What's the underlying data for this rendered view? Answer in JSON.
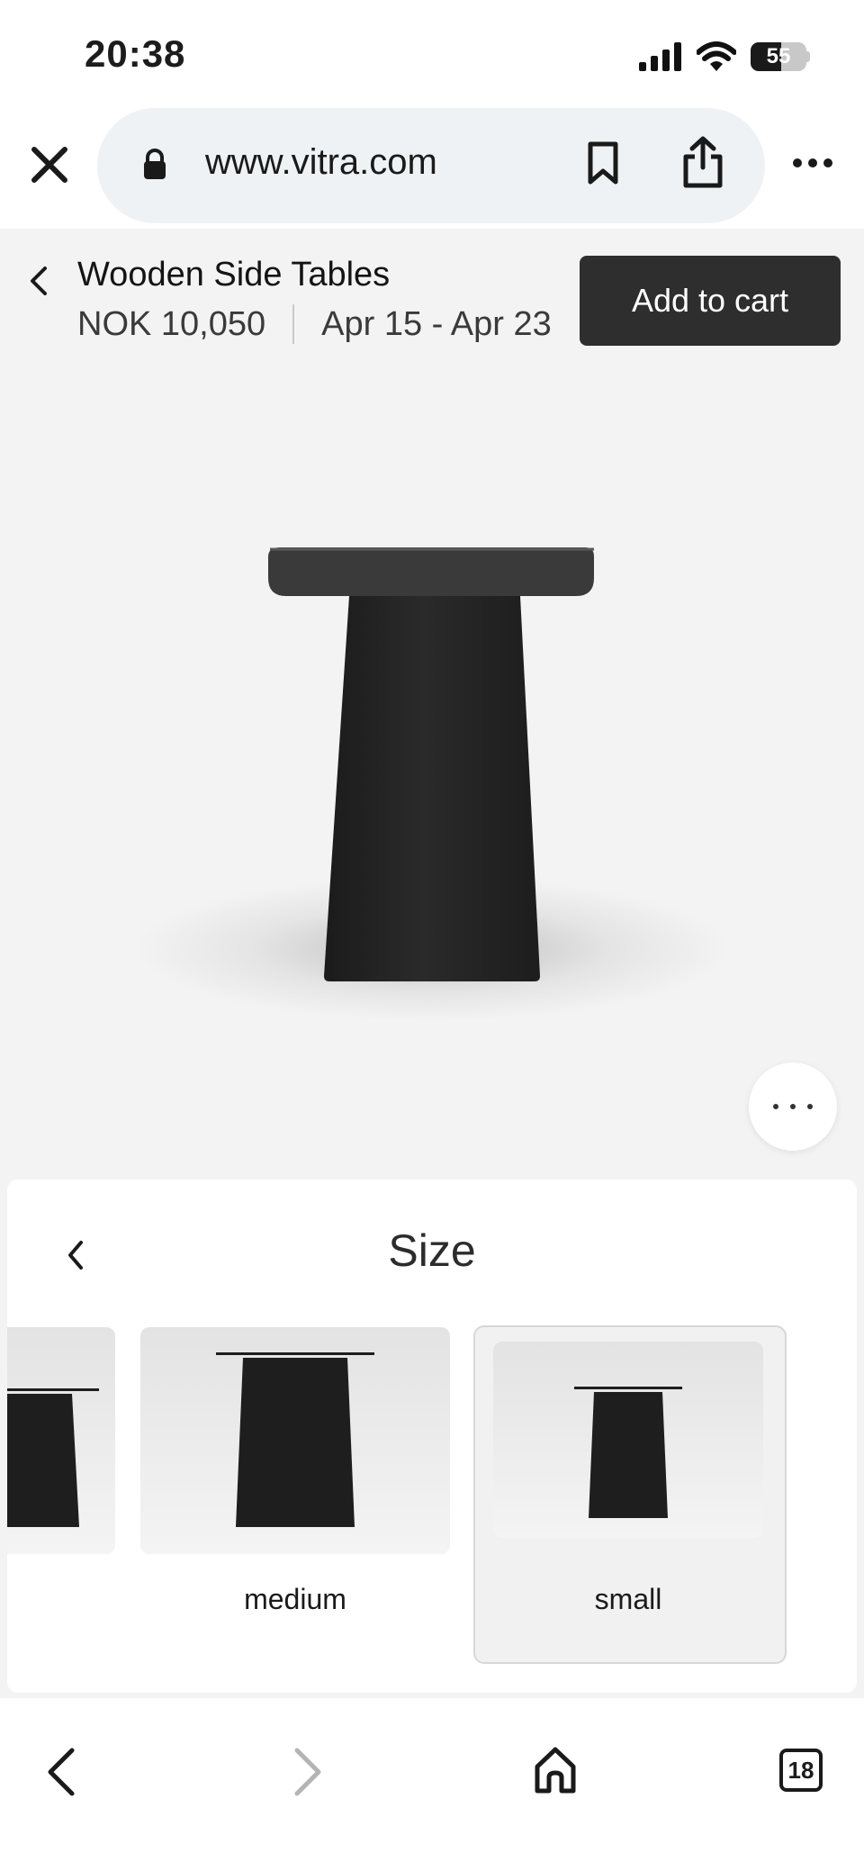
{
  "status_bar": {
    "time": "20:38",
    "battery_level": "55",
    "battery_fraction": 0.55
  },
  "browser": {
    "url": "www.vitra.com",
    "tab_count": "18"
  },
  "product": {
    "title": "Wooden Side Tables",
    "price": "NOK 10,050",
    "delivery": "Apr 15 - Apr 23",
    "add_to_cart_label": "Add to cart"
  },
  "size_picker": {
    "title": "Size",
    "options": [
      {
        "label": ""
      },
      {
        "label": "medium"
      },
      {
        "label": "small",
        "selected": true
      }
    ]
  },
  "colors": {
    "accent": "#2e2e2e",
    "table": "#232323",
    "background": "#f3f3f3"
  }
}
